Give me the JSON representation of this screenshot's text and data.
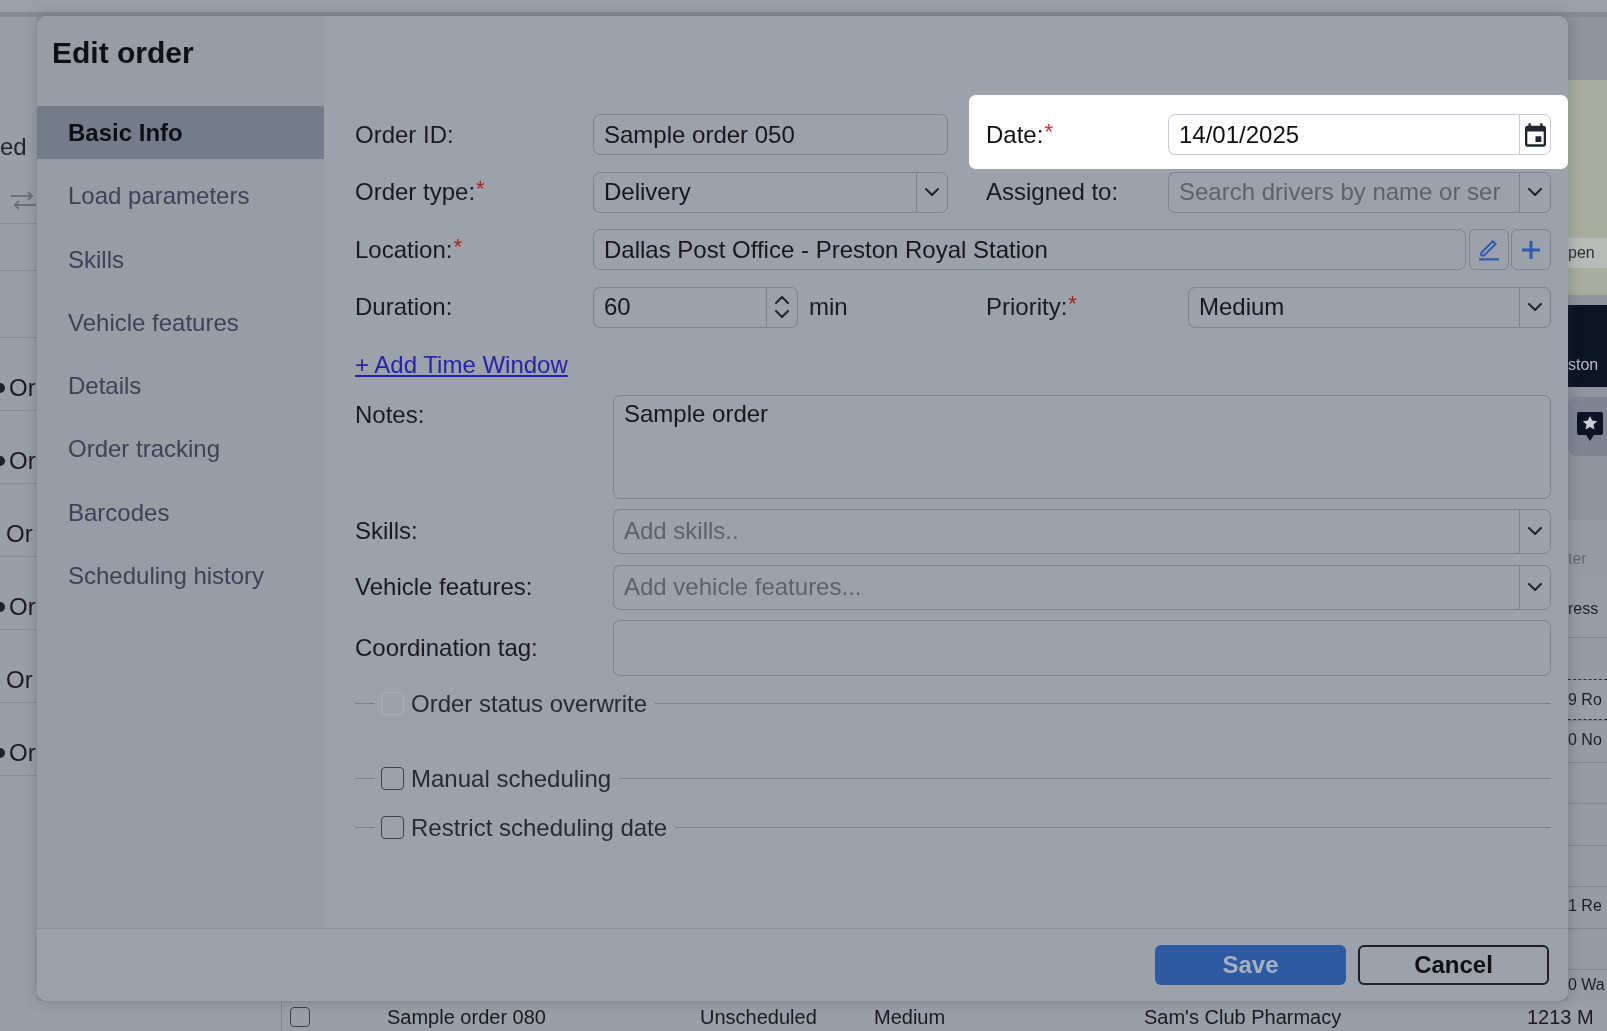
{
  "app": {
    "left_panel": {
      "heading": "ed",
      "rows": [
        {
          "text": "Or",
          "marked": true
        },
        {
          "text": "Or",
          "marked": true
        },
        {
          "text": "Or",
          "marked": false
        },
        {
          "text": "Or",
          "marked": true
        },
        {
          "text": "Or",
          "marked": false
        },
        {
          "text": "Or",
          "marked": true
        }
      ]
    },
    "right_panel": {
      "map_label": "pen",
      "banner": "ston",
      "filter_field": {
        "placeholder": "ter"
      },
      "column_header": "ress",
      "rows": [
        {
          "text": "9 Ro",
          "selected": true
        },
        {
          "text": "0 No",
          "selected": false
        },
        {
          "text": "1 Re",
          "selected": false
        },
        {
          "text": "0 Wa",
          "selected": false
        }
      ]
    },
    "bottom_row": {
      "checked": false,
      "cells": [
        "Sample order 080",
        "Unscheduled",
        "Medium",
        "Sam's Club Pharmacy",
        "1213 M"
      ]
    }
  },
  "dialog": {
    "title": "Edit order",
    "nav": [
      {
        "label": "Basic Info",
        "selected": true
      },
      {
        "label": "Load parameters",
        "selected": false
      },
      {
        "label": "Skills",
        "selected": false
      },
      {
        "label": "Vehicle features",
        "selected": false
      },
      {
        "label": "Details",
        "selected": false
      },
      {
        "label": "Order tracking",
        "selected": false
      },
      {
        "label": "Barcodes",
        "selected": false
      },
      {
        "label": "Scheduling history",
        "selected": false
      }
    ],
    "order_id": {
      "label": "Order ID:",
      "kind": "text",
      "value": "Sample order 050"
    },
    "date": {
      "label": "Date:",
      "required_mark": "*",
      "kind": "date",
      "value": "14/01/2025",
      "highlighted": true
    },
    "order_type": {
      "label": "Order type:",
      "required_mark": "*",
      "kind": "select",
      "value": "Delivery"
    },
    "assigned_to": {
      "label": "Assigned to:",
      "kind": "select",
      "placeholder": "Search drivers by name or ser"
    },
    "location": {
      "label": "Location:",
      "required_mark": "*",
      "kind": "text",
      "value": "Dallas Post Office - Preston Royal Station",
      "buttons": [
        {
          "kind": "edit"
        },
        {
          "kind": "add"
        }
      ]
    },
    "duration": {
      "label": "Duration:",
      "kind": "number",
      "value": "60",
      "unit": "min"
    },
    "priority": {
      "label": "Priority:",
      "required_mark": "*",
      "kind": "select",
      "value": "Medium"
    },
    "time_window_link": "+ Add Time Window",
    "notes": {
      "label": "Notes:",
      "kind": "textarea",
      "value": "Sample order"
    },
    "skills": {
      "label": "Skills:",
      "kind": "select",
      "placeholder": "Add skills.."
    },
    "vehicle_features": {
      "label": "Vehicle features:",
      "kind": "select",
      "placeholder": "Add vehicle features..."
    },
    "coordination_tag": {
      "label": "Coordination tag:",
      "kind": "text"
    },
    "sections": [
      {
        "label": "Order status overwrite",
        "checked": false,
        "disabled": true
      },
      {
        "label": "Manual scheduling",
        "checked": false,
        "disabled": false
      },
      {
        "label": "Restrict scheduling date",
        "checked": false,
        "disabled": false
      }
    ],
    "buttons": [
      {
        "label": "Save",
        "kind": "primary"
      },
      {
        "label": "Cancel",
        "kind": "secondary"
      }
    ]
  }
}
